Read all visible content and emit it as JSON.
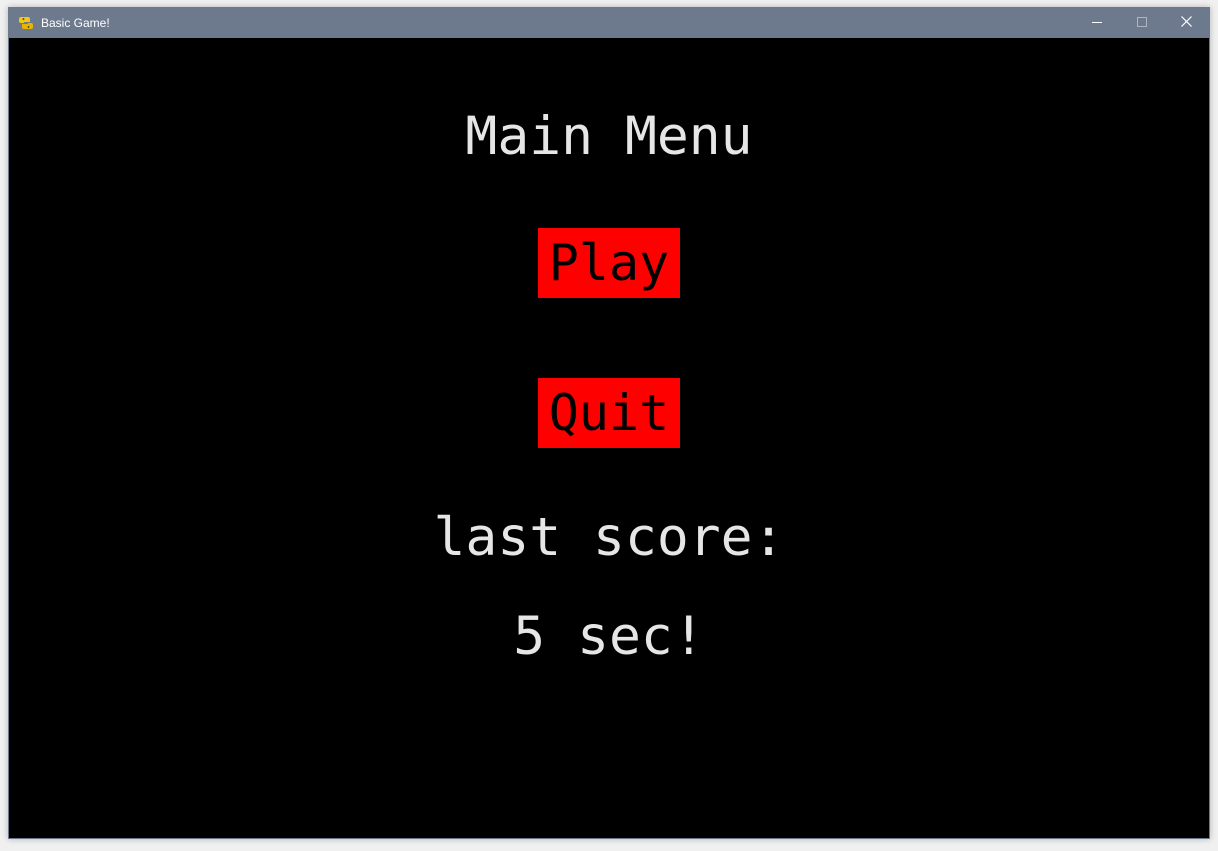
{
  "window": {
    "title": "Basic Game!",
    "app_icon": "python-snake-icon",
    "controls": {
      "minimize_icon": "minimize-icon",
      "maximize_icon": "maximize-icon",
      "close_icon": "close-icon"
    },
    "titlebar_color": "#6d7a8d"
  },
  "game": {
    "background": "#000000",
    "heading": "Main Menu",
    "buttons": {
      "play_label": "Play",
      "quit_label": "Quit",
      "button_color": "#ff0000"
    },
    "last_score_label": "last score:",
    "last_score_value": "5 sec!"
  }
}
